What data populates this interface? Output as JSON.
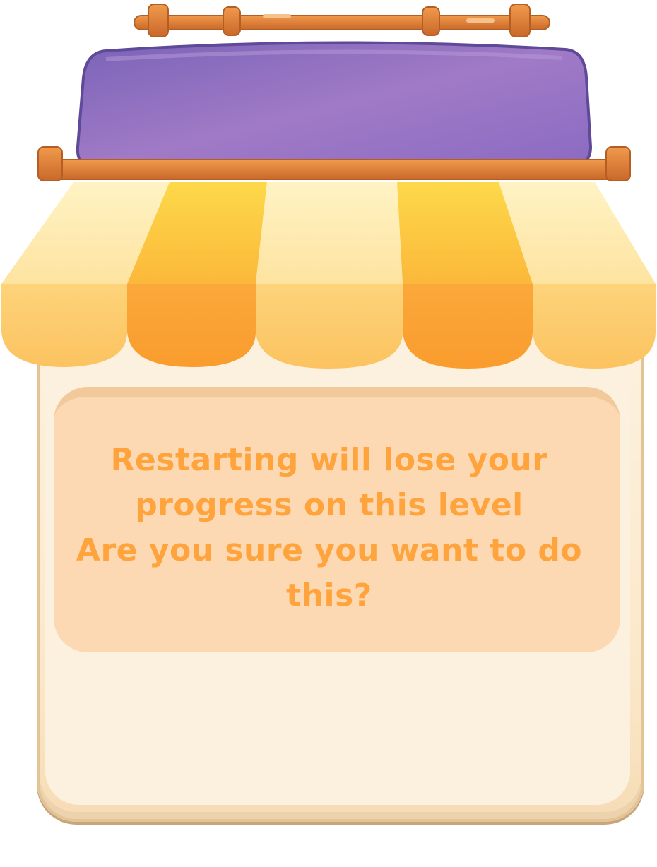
{
  "dialog": {
    "message_line1": "Restarting will lose your",
    "message_line2": "progress on this level",
    "message_line3": "Are you sure you want to do",
    "message_line4": "this?"
  },
  "colors": {
    "sign_purple": "#8a6bc0",
    "awning_light": "#fde9a6",
    "awning_dark": "#fbc53b",
    "wood": "#e5833a",
    "panel": "#fcf1de",
    "message_bg": "#fcd9b3",
    "message_text": "#ffa43d"
  }
}
